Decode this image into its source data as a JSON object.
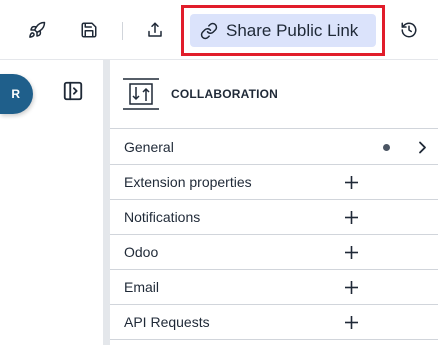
{
  "toolbar": {
    "buttons": [
      {
        "icon": "rocket-icon",
        "label": ""
      },
      {
        "icon": "save-icon",
        "label": ""
      },
      {
        "icon": "upload-icon",
        "label": ""
      },
      {
        "icon": "history-icon",
        "label": ""
      }
    ],
    "share_button": {
      "label": "Share Public Link",
      "icon": "link-icon"
    }
  },
  "rail": {
    "avatar_initial": "R",
    "toggle_icon": "panel-toggle-icon"
  },
  "panel": {
    "title": "COLLABORATION",
    "header_icon": "gateway-icon",
    "rows": [
      {
        "label": "General",
        "indicator": "dot",
        "action_icon": "chevron-right-icon"
      },
      {
        "label": "Extension properties",
        "action_icon": "plus-icon"
      },
      {
        "label": "Notifications",
        "action_icon": "plus-icon"
      },
      {
        "label": "Odoo",
        "action_icon": "plus-icon"
      },
      {
        "label": "Email",
        "action_icon": "plus-icon"
      },
      {
        "label": "API Requests",
        "action_icon": "plus-icon"
      }
    ]
  },
  "colors": {
    "share_bg": "#dbe3fb",
    "highlight_border": "#e11d2a",
    "avatar_bg": "#1f5f8b"
  }
}
